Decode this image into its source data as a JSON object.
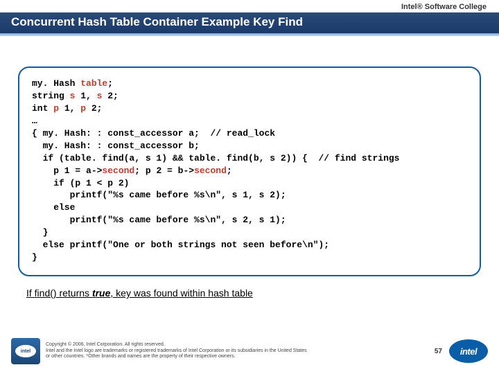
{
  "header": {
    "brand": "Intel® Software College"
  },
  "title": "Concurrent Hash Table Container Example Key Find",
  "code": {
    "l0a": "my. Hash ",
    "l0b": "table",
    "l0c": ";",
    "l1a": "string ",
    "l1b": "s",
    "l1c": " 1, ",
    "l1d": "s",
    "l1e": " 2;",
    "l2a": "int ",
    "l2b": "p",
    "l2c": " 1, ",
    "l2d": "p",
    "l2e": " 2;",
    "l3": "…",
    "l4": "{ my. Hash: : const_accessor a;  // read_lock",
    "l5": "  my. Hash: : const_accessor b;",
    "l6": "  if (table. find(a, s 1) && table. find(b, s 2)) {  // find strings",
    "l7a": "    p 1 = a->",
    "l7b": "second",
    "l7c": "; p 2 = b->",
    "l7d": "second",
    "l7e": ";",
    "l8": "    if (p 1 < p 2)",
    "l9": "       printf(\"%s came before %s\\n\", s 1, s 2);",
    "l10": "    else",
    "l11": "       printf(\"%s came before %s\\n\", s 2, s 1);",
    "l12": "  }",
    "l13": "  else printf(\"One or both strings not seen before\\n\");",
    "l14": "}"
  },
  "note": {
    "a": "If ",
    "b": "find()",
    "c": " returns ",
    "d": "true",
    "e": ", key was found within hash table"
  },
  "footer": {
    "copy1": "Copyright © 2006, Intel Corporation. All rights reserved.",
    "copy2": "Intel and the Intel logo are trademarks or registered trademarks of Intel Corporation or its subsidiaries in the United States",
    "copy3": "or other countries. *Other brands and names are the property of their respective owners.",
    "page": "57",
    "logo_small": "intel",
    "logo_big": "intel"
  }
}
